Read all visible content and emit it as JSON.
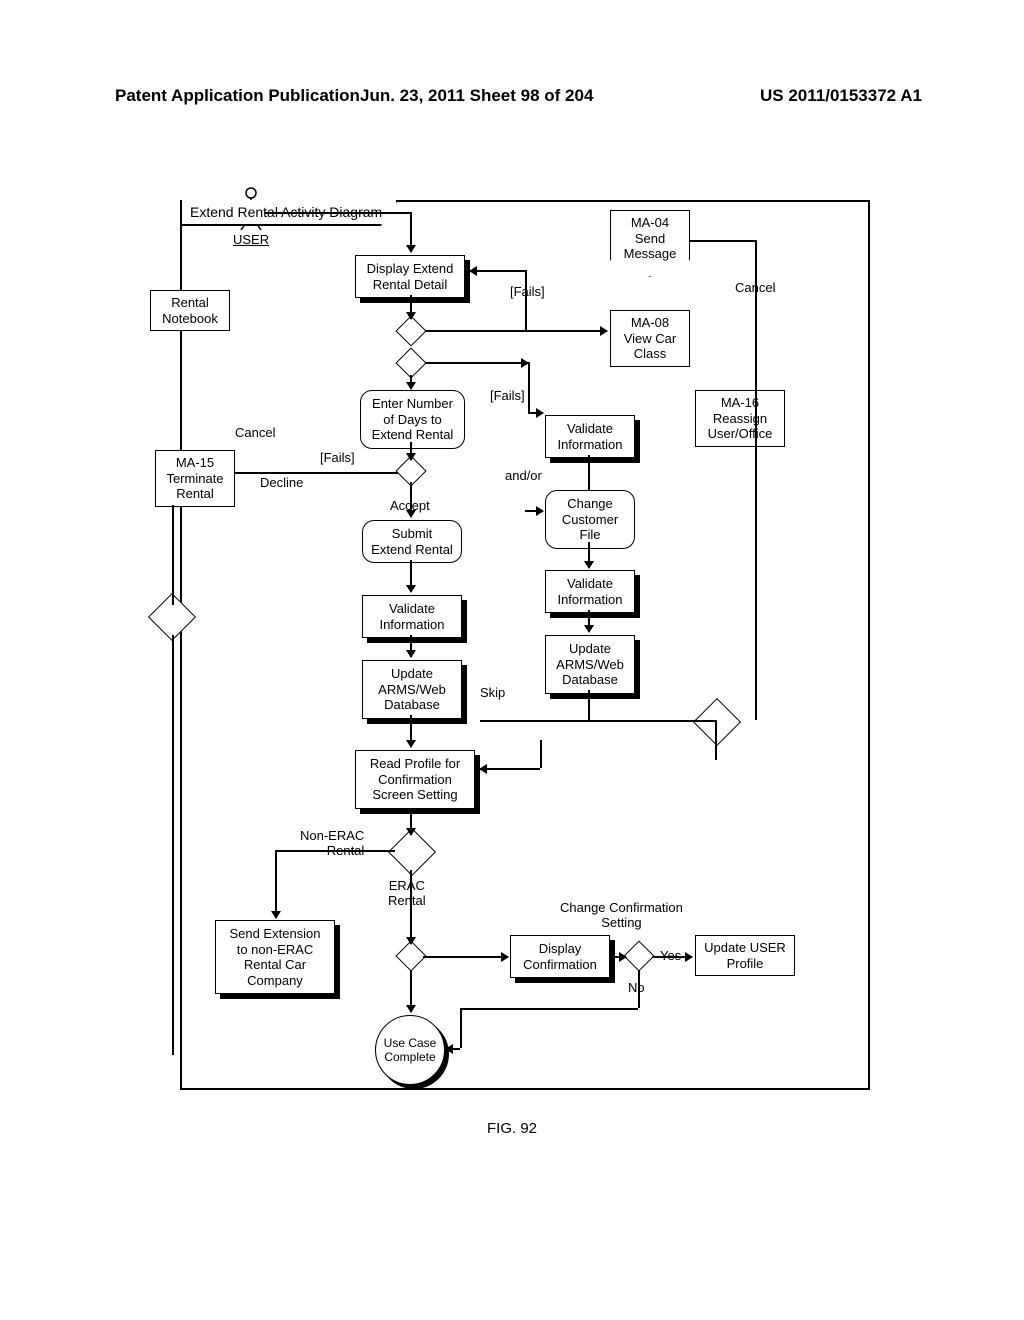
{
  "header": {
    "left": "Patent Application Publication",
    "mid": "Jun. 23, 2011  Sheet 98 of 204",
    "right": "US 2011/0153372 A1"
  },
  "title": "Extend Rental Activity Diagram",
  "actor": {
    "label": "USER"
  },
  "figure_label": "FIG. 92",
  "nodes": {
    "rental_notebook": "Rental\nNotebook",
    "ma15": "MA-15\nTerminate\nRental",
    "ma04": "MA-04\nSend\nMessage",
    "ma08": "MA-08\nView Car\nClass",
    "ma16": "MA-16\nReassign\nUser/Office",
    "display_extend": "Display Extend\nRental Detail",
    "enter_days": "Enter Number\nof Days to\nExtend Rental",
    "submit_extend": "Submit\nExtend Rental",
    "validate_info_1": "Validate\nInformation",
    "update_arms_1": "Update\nARMS/Web\nDatabase",
    "read_profile": "Read Profile for\nConfirmation\nScreen Setting",
    "send_extension": "Send Extension\nto non-ERAC\nRental Car\nCompany",
    "use_case_complete": "Use Case\nComplete",
    "validate_info_2": "Validate\nInformation",
    "change_customer": "Change\nCustomer\nFile",
    "validate_info_3": "Validate\nInformation",
    "update_arms_2": "Update\nARMS/Web\nDatabase",
    "display_confirmation": "Display\nConfirmation",
    "update_user_profile": "Update USER\nProfile"
  },
  "labels": {
    "cancel1": "Cancel",
    "cancel2": "Cancel",
    "fails1": "[Fails]",
    "fails2": "[Fails]",
    "fails3": "[Fails]",
    "decline": "Decline",
    "accept": "Accept",
    "andor": "and/or",
    "skip": "Skip",
    "non_erac": "Non-ERAC\nRental",
    "erac": "ERAC\nRental",
    "change_conf": "Change Confirmation\nSetting",
    "yes": "Yes",
    "no": "No"
  }
}
